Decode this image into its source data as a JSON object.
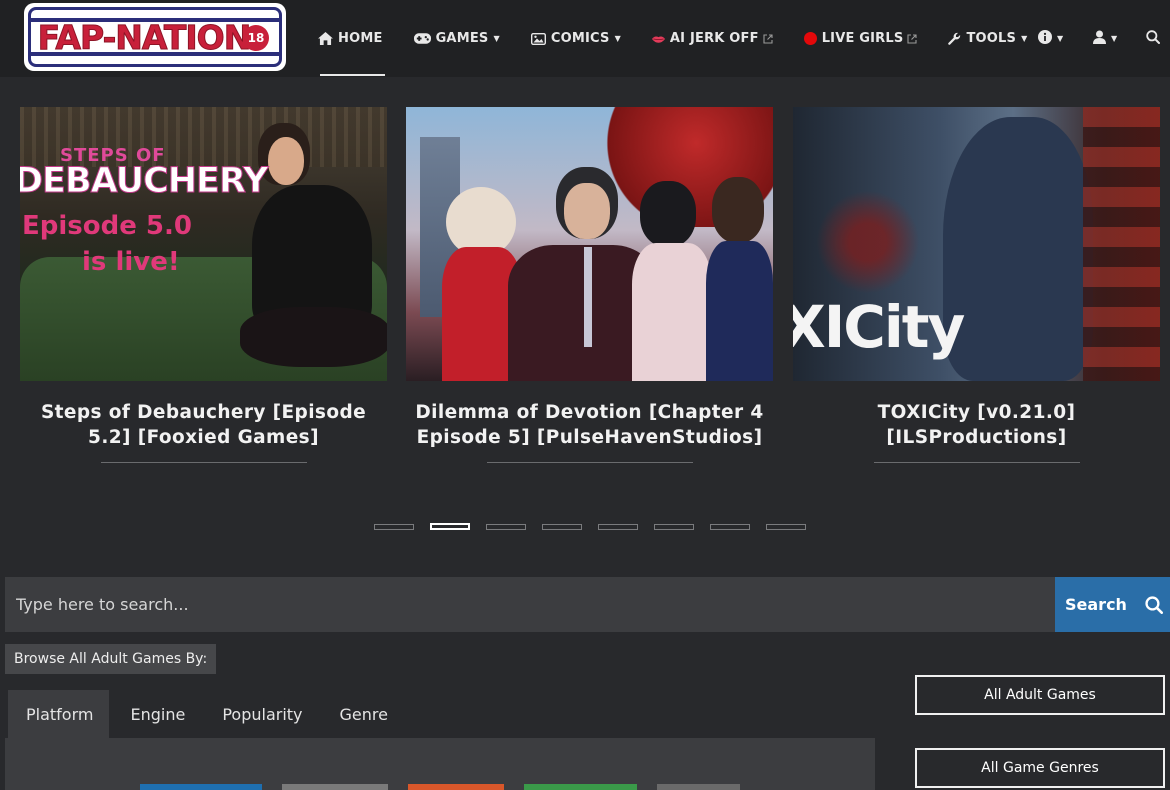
{
  "header": {
    "logo_text": "FAP-NATION",
    "logo_badge": "18",
    "nav": [
      {
        "label": "HOME",
        "active": true
      },
      {
        "label": "GAMES",
        "caret": true
      },
      {
        "label": "COMICS",
        "caret": true
      },
      {
        "label": "AI JERK OFF",
        "external": true
      },
      {
        "label": "LIVE GIRLS",
        "external": true
      },
      {
        "label": "TOOLS",
        "caret": true
      }
    ]
  },
  "slider": {
    "slides": [
      {
        "title": "Steps of Debauchery [Episode 5.2] [Fooxied Games]",
        "image_text_top": "STEPS OF",
        "image_text_main": "DEBAUCHERY",
        "image_text_sub1": "Episode 5.0",
        "image_text_sub2": "is live!"
      },
      {
        "title": "Dilemma of Devotion [Chapter 4 Episode 5] [PulseHavenStudios]"
      },
      {
        "title": "TOXICity [v0.21.0] [ILSProductions]",
        "image_text_main": "XICity"
      }
    ],
    "dot_count": 8,
    "active_dot": 1
  },
  "search": {
    "placeholder": "Type here to search...",
    "button_label": "Search"
  },
  "browse": {
    "label": "Browse All Adult Games By:",
    "tabs": [
      "Platform",
      "Engine",
      "Popularity",
      "Genre"
    ],
    "active_tab": 0,
    "pill_colors": [
      "#1e6fb0",
      "#7a7a7a",
      "#d9572a",
      "#3a9a49",
      "#6a6a6a"
    ]
  },
  "sidebar": {
    "buttons": [
      "All Adult Games",
      "All Game Genres"
    ]
  },
  "colors": {
    "background": "#28292c",
    "header": "#202123",
    "accent": "#2a6ea8",
    "logo_red": "#c8203a",
    "logo_navy": "#2b2e7a"
  }
}
